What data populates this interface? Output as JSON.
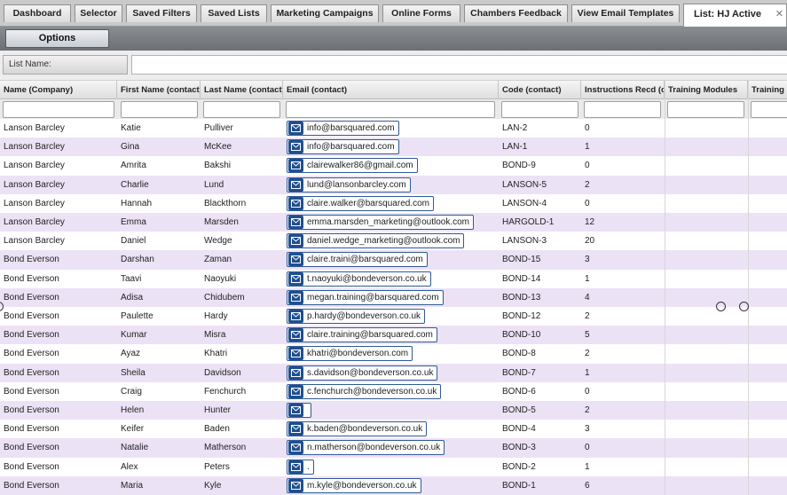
{
  "tabs": [
    {
      "label": "Dashboard",
      "active": false
    },
    {
      "label": "Selector",
      "active": false
    },
    {
      "label": "Saved Filters",
      "active": false
    },
    {
      "label": "Saved Lists",
      "active": false
    },
    {
      "label": "Marketing Campaigns",
      "active": false
    },
    {
      "label": "Online Forms",
      "active": false
    },
    {
      "label": "Chambers Feedback",
      "active": false
    },
    {
      "label": "View Email Templates",
      "active": false
    },
    {
      "label": "List: HJ Active",
      "active": true,
      "close": "✕"
    }
  ],
  "toolbar": {
    "options_label": "Options"
  },
  "list_name": {
    "label": "List Name:",
    "value": ""
  },
  "columns": [
    "Name (Company)",
    "First Name (contact)",
    "Last Name (contact)",
    "Email (contact)",
    "Code (contact)",
    "Instructions Recd (c",
    "Training Modules",
    "Training I"
  ],
  "rows": [
    {
      "company": "Lanson Barcley",
      "first": "Katie",
      "last": "Pulliver",
      "email": "info@barsquared.com",
      "code": "LAN-2",
      "instructions": "0"
    },
    {
      "company": "Lanson Barcley",
      "first": "Gina",
      "last": "McKee",
      "email": "info@barsquared.com",
      "code": "LAN-1",
      "instructions": "1"
    },
    {
      "company": "Lanson Barcley",
      "first": "Amrita",
      "last": "Bakshi",
      "email": "clairewalker86@gmail.com",
      "code": "BOND-9",
      "instructions": "0"
    },
    {
      "company": "Lanson Barcley",
      "first": "Charlie",
      "last": "Lund",
      "email": "lund@lansonbarcley.com",
      "code": "LANSON-5",
      "instructions": "2"
    },
    {
      "company": "Lanson Barcley",
      "first": "Hannah",
      "last": "Blackthorn",
      "email": "claire.walker@barsquared.com",
      "code": "LANSON-4",
      "instructions": "0"
    },
    {
      "company": "Lanson Barcley",
      "first": "Emma",
      "last": "Marsden",
      "email": "emma.marsden_marketing@outlook.com",
      "code": "HARGOLD-1",
      "instructions": "12"
    },
    {
      "company": "Lanson Barcley",
      "first": "Daniel",
      "last": "Wedge",
      "email": "daniel.wedge_marketing@outlook.com",
      "code": "LANSON-3",
      "instructions": "20"
    },
    {
      "company": "Bond Everson",
      "first": "Darshan",
      "last": "Zaman",
      "email": "claire.traini@barsquared.com",
      "code": "BOND-15",
      "instructions": "3"
    },
    {
      "company": "Bond Everson",
      "first": "Taavi",
      "last": "Naoyuki",
      "email": "t.naoyuki@bondeverson.co.uk",
      "code": "BOND-14",
      "instructions": "1"
    },
    {
      "company": "Bond Everson",
      "first": "Adisa",
      "last": "Chidubem",
      "email": "megan.training@barsquared.com",
      "code": "BOND-13",
      "instructions": "4"
    },
    {
      "company": "Bond Everson",
      "first": "Paulette",
      "last": "Hardy",
      "email": "p.hardy@bondeverson.co.uk",
      "code": "BOND-12",
      "instructions": "2"
    },
    {
      "company": "Bond Everson",
      "first": "Kumar",
      "last": "Misra",
      "email": "claire.training@barsquared.com",
      "code": "BOND-10",
      "instructions": "5"
    },
    {
      "company": "Bond Everson",
      "first": "Ayaz",
      "last": "Khatri",
      "email": "khatri@bondeverson.com",
      "code": "BOND-8",
      "instructions": "2"
    },
    {
      "company": "Bond Everson",
      "first": "Sheila",
      "last": "Davidson",
      "email": "s.davidson@bondeverson.co.uk",
      "code": "BOND-7",
      "instructions": "1"
    },
    {
      "company": "Bond Everson",
      "first": "Craig",
      "last": "Fenchurch",
      "email": "c.fenchurch@bondeverson.co.uk",
      "code": "BOND-6",
      "instructions": "0"
    },
    {
      "company": "Bond Everson",
      "first": "Helen",
      "last": "Hunter",
      "email": "",
      "code": "BOND-5",
      "instructions": "2"
    },
    {
      "company": "Bond Everson",
      "first": "Keifer",
      "last": "Baden",
      "email": "k.baden@bondeverson.co.uk",
      "code": "BOND-4",
      "instructions": "3"
    },
    {
      "company": "Bond Everson",
      "first": "Natalie",
      "last": "Matherson",
      "email": "n.matherson@bondeverson.co.uk",
      "code": "BOND-3",
      "instructions": "0"
    },
    {
      "company": "Bond Everson",
      "first": "Alex",
      "last": "Peters",
      "email": ".",
      "code": "BOND-2",
      "instructions": "1"
    },
    {
      "company": "Bond Everson",
      "first": "Maria",
      "last": "Kyle",
      "email": "m.kyle@bondeverson.co.uk",
      "code": "BOND-1",
      "instructions": "6"
    }
  ],
  "colors": {
    "even_row": "#ece2f5",
    "email_icon": "#1f4f8f",
    "toolbar": "#7b7e83"
  }
}
